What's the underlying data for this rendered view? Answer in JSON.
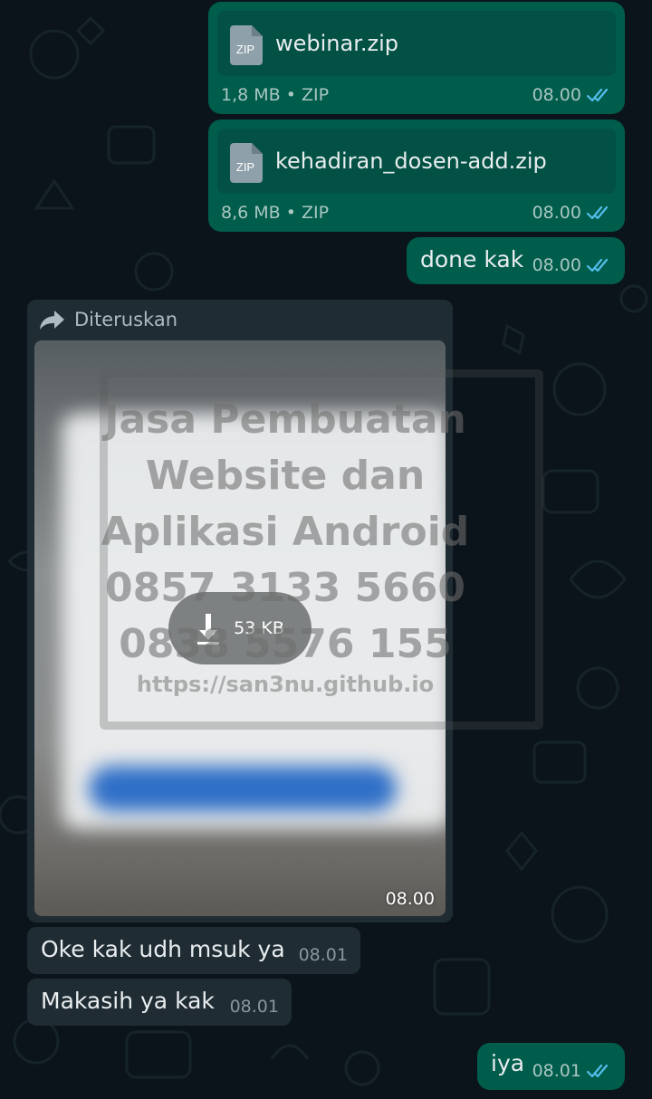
{
  "messages": {
    "file1": {
      "name": "webinar.zip",
      "meta": "1,8 MB • ZIP",
      "time": "08.00",
      "icon_label": "ZIP"
    },
    "file2": {
      "name": "kehadiran_dosen-add.zip",
      "meta": "8,6 MB • ZIP",
      "time": "08.00",
      "icon_label": "ZIP"
    },
    "done": {
      "text": "done kak",
      "time": "08.00"
    },
    "forwarded": {
      "label": "Diteruskan",
      "download_size": "53 KB",
      "time": "08.00",
      "watermark": [
        "Jasa Pembuatan",
        "Website dan",
        "Aplikasi Android",
        "0857 3133 5660",
        "0838 5576 155",
        "https://san3nu.github.io"
      ]
    },
    "oke": {
      "text": "Oke kak udh msuk ya",
      "time": "08.01"
    },
    "makasih": {
      "text": "Makasih ya kak",
      "time": "08.01"
    },
    "iya": {
      "text": "iya",
      "time": "08.01"
    }
  },
  "colors": {
    "background": "#0b141a",
    "outgoing_bubble": "#005c4b",
    "incoming_bubble": "#1f2c34",
    "read_tick": "#53bdeb"
  },
  "icons": {
    "file": "zip-file-icon",
    "status": "double-check-read-icon",
    "forward": "forward-arrow-icon",
    "download": "download-arrow-icon"
  }
}
